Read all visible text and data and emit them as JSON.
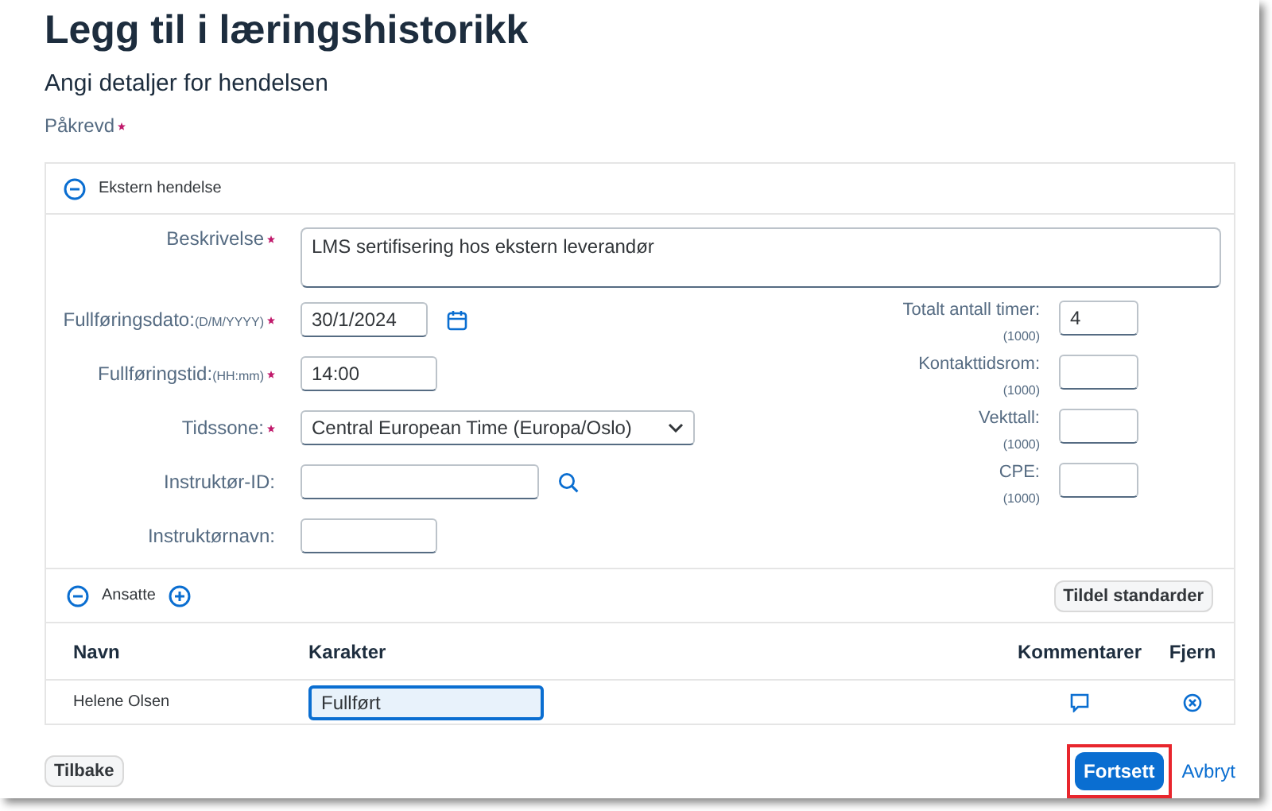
{
  "title": "Legg til i læringshistorikk",
  "subtitle": "Angi detaljer for hendelsen",
  "required_note": "Påkrevd",
  "event_section": {
    "title": "Ekstern hendelse",
    "expanded": true,
    "description": {
      "label": "Beskrivelse",
      "required": true,
      "value": "LMS sertifisering hos ekstern leverandør"
    },
    "left_fields": [
      {
        "kind": "date",
        "label": "Fullføringsdato:",
        "hint": "(D/M/YYYY)",
        "required": true,
        "value": "30/1/2024"
      },
      {
        "kind": "text",
        "label": "Fullføringstid:",
        "hint": "(HH:mm)",
        "required": true,
        "value": "14:00"
      },
      {
        "kind": "select",
        "label": "Tidssone:",
        "required": true,
        "value": "Central European Time (Europa/Oslo)"
      },
      {
        "kind": "search",
        "label": "Instruktør-ID:",
        "required": false
      },
      {
        "kind": "text",
        "label": "Instruktørnavn:",
        "required": false
      }
    ],
    "right_fields": [
      {
        "label": "Totalt antall timer:",
        "hint": "(1000)",
        "value": "4"
      },
      {
        "label": "Kontakttidsrom:",
        "hint": "(1000)"
      },
      {
        "label": "Vekttall:",
        "hint": "(1000)"
      },
      {
        "label": "CPE:",
        "hint": "(1000)"
      }
    ]
  },
  "employees_section": {
    "title": "Ansatte",
    "expanded": true,
    "assign_button": "Tildel standarder",
    "columns": [
      "Navn",
      "Karakter",
      "Kommentarer",
      "Fjern"
    ],
    "rows": [
      {
        "name": "Helene Olsen",
        "grade": "Fullført",
        "focused": true
      }
    ]
  },
  "footer": {
    "back": "Tilbake",
    "continue": "Fortsett",
    "continue_highlighted": true,
    "cancel": "Avbryt"
  }
}
